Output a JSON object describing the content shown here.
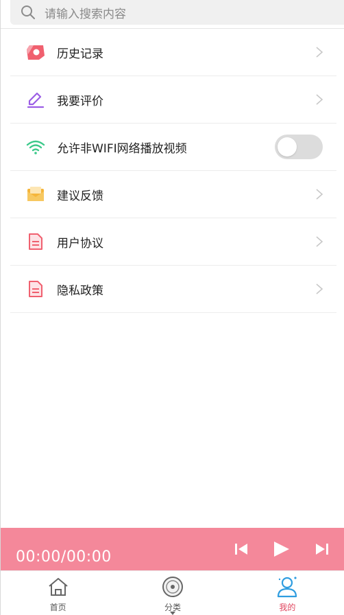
{
  "search": {
    "placeholder": "请输入搜索内容"
  },
  "menu": {
    "items": [
      {
        "label": "历史记录",
        "icon": "history-icon",
        "color": "#f0606f"
      },
      {
        "label": "我要评价",
        "icon": "edit-pen-icon",
        "color": "#9b5de5"
      },
      {
        "label": "允许非WIFI网络播放视频",
        "icon": "wifi-icon",
        "color": "#3cc98a",
        "toggle": false
      },
      {
        "label": "建议反馈",
        "icon": "envelope-icon",
        "color": "#f5b53a"
      },
      {
        "label": "用户协议",
        "icon": "document-icon",
        "color": "#f0606f"
      },
      {
        "label": "隐私政策",
        "icon": "document-icon",
        "color": "#f0606f"
      }
    ]
  },
  "player": {
    "time": "00:00/00:00",
    "bg_color": "#f4889a"
  },
  "nav": {
    "items": [
      {
        "label": "首页",
        "icon": "home-icon"
      },
      {
        "label": "分类",
        "icon": "disc-icon"
      },
      {
        "label": "我的",
        "icon": "user-icon",
        "active": true
      }
    ],
    "active_color": "#e0455e"
  }
}
